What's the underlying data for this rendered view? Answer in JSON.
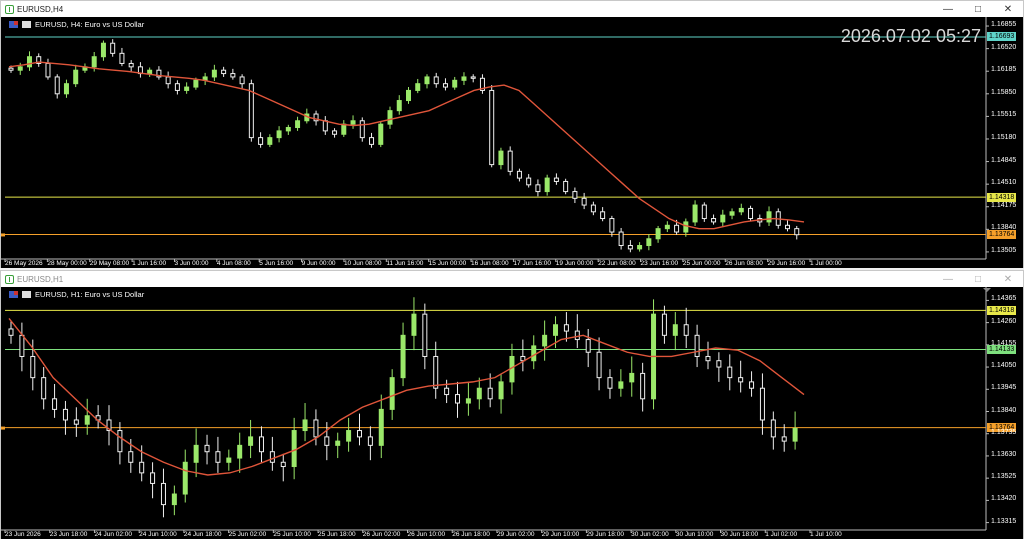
{
  "window1": {
    "title": "EURUSD,H4",
    "header": "EURUSD, H4:  Euro vs US Dollar",
    "clock": "2026.07.02 05:27",
    "price_scale": [
      "1.16855",
      "1.16520",
      "1.16185",
      "1.15850",
      "1.15515",
      "1.15180",
      "1.14845",
      "1.14510",
      "1.14175",
      "1.13840",
      "1.13505"
    ],
    "levels": [
      {
        "value": "1.16693",
        "color": "#5fd3c8"
      },
      {
        "value": "1.14318",
        "color": "#e8e84a"
      },
      {
        "value": "1.13764",
        "color": "#f5a02a"
      }
    ],
    "time_labels": [
      "26 May 2026",
      "28 May 00:00",
      "29 May 08:00",
      "1 Jun 16:00",
      "3 Jun 00:00",
      "4 Jun 08:00",
      "5 Jun 16:00",
      "9 Jun 00:00",
      "10 Jun 08:00",
      "11 Jun 16:00",
      "15 Jun 00:00",
      "16 Jun 08:00",
      "17 Jun 16:00",
      "19 Jun 00:00",
      "22 Jun 08:00",
      "23 Jun 16:00",
      "25 Jun 00:00",
      "26 Jun 08:00",
      "29 Jun 16:00",
      "1 Jul 00:00"
    ]
  },
  "window2": {
    "title": "EURUSD,H1",
    "header": "EURUSD, H1:  Euro vs US Dollar",
    "price_scale": [
      "1.14365",
      "1.14260",
      "1.14155",
      "1.14050",
      "1.13945",
      "1.13840",
      "1.13735",
      "1.13630",
      "1.13525",
      "1.13420",
      "1.13315"
    ],
    "levels": [
      {
        "value": "1.14318",
        "color": "#e8e84a"
      },
      {
        "value": "1.14133",
        "color": "#7ee07e"
      },
      {
        "value": "1.13764",
        "color": "#f5a02a"
      }
    ],
    "time_labels": [
      "23 Jun 2026",
      "23 Jun 18:00",
      "24 Jun 02:00",
      "24 Jun 10:00",
      "24 Jun 18:00",
      "25 Jun 02:00",
      "25 Jun 10:00",
      "25 Jun 18:00",
      "26 Jun 02:00",
      "26 Jun 10:00",
      "26 Jun 18:00",
      "29 Jun 02:00",
      "29 Jun 10:00",
      "29 Jun 18:00",
      "30 Jun 02:00",
      "30 Jun 10:00",
      "30 Jun 18:00",
      "1 Jul 02:00",
      "1 Jul 10:00"
    ]
  },
  "colors": {
    "bull": "#9be86a",
    "bear": "#f0f0f0",
    "ma": "#e0553a",
    "chart_bg": "#000000"
  },
  "chart_data": [
    {
      "type": "candlestick",
      "title": "EURUSD, H4:  Euro vs US Dollar",
      "ylim": [
        1.134,
        1.169
      ],
      "close_series_approx": [
        1.162,
        1.1625,
        1.164,
        1.163,
        1.161,
        1.1585,
        1.16,
        1.162,
        1.1625,
        1.164,
        1.166,
        1.1645,
        1.163,
        1.1625,
        1.1615,
        1.162,
        1.161,
        1.16,
        1.159,
        1.1595,
        1.1605,
        1.161,
        1.162,
        1.1615,
        1.161,
        1.16,
        1.152,
        1.151,
        1.152,
        1.153,
        1.1535,
        1.1545,
        1.1555,
        1.1545,
        1.153,
        1.1525,
        1.154,
        1.1545,
        1.152,
        1.151,
        1.154,
        1.156,
        1.1575,
        1.159,
        1.16,
        1.161,
        1.16,
        1.1595,
        1.1605,
        1.161,
        1.1608,
        1.159,
        1.148,
        1.15,
        1.147,
        1.146,
        1.145,
        1.144,
        1.146,
        1.1455,
        1.144,
        1.143,
        1.142,
        1.141,
        1.14,
        1.138,
        1.136,
        1.1355,
        1.136,
        1.137,
        1.1385,
        1.139,
        1.138,
        1.1395,
        1.142,
        1.14,
        1.1395,
        1.1405,
        1.141,
        1.1415,
        1.14,
        1.1395,
        1.141,
        1.139,
        1.1385,
        1.1376
      ],
      "ma_series_approx": [
        1.1625,
        1.1628,
        1.1632,
        1.163,
        1.1628,
        1.1625,
        1.1622,
        1.162,
        1.1618,
        1.1615,
        1.1612,
        1.161,
        1.1608,
        1.1605,
        1.16,
        1.1595,
        1.159,
        1.158,
        1.157,
        1.156,
        1.155,
        1.1545,
        1.154,
        1.1538,
        1.154,
        1.1545,
        1.155,
        1.1555,
        1.156,
        1.157,
        1.158,
        1.159,
        1.1595,
        1.1598,
        1.159,
        1.157,
        1.155,
        1.153,
        1.151,
        1.149,
        1.147,
        1.145,
        1.143,
        1.1415,
        1.14,
        1.139,
        1.1385,
        1.1385,
        1.139,
        1.1395,
        1.1398,
        1.14,
        1.1398,
        1.1395
      ]
    },
    {
      "type": "candlestick",
      "title": "EURUSD, H1:  Euro vs US Dollar",
      "ylim": [
        1.1328,
        1.144
      ],
      "close_series_approx": [
        1.142,
        1.141,
        1.14,
        1.139,
        1.1385,
        1.138,
        1.1378,
        1.1382,
        1.138,
        1.1375,
        1.1365,
        1.136,
        1.1355,
        1.135,
        1.134,
        1.1345,
        1.136,
        1.1368,
        1.1365,
        1.136,
        1.1362,
        1.1368,
        1.1372,
        1.1365,
        1.136,
        1.1358,
        1.1375,
        1.138,
        1.1372,
        1.1368,
        1.137,
        1.1375,
        1.1372,
        1.1368,
        1.1385,
        1.14,
        1.142,
        1.143,
        1.141,
        1.1395,
        1.1392,
        1.1388,
        1.139,
        1.1395,
        1.139,
        1.1398,
        1.141,
        1.1408,
        1.1415,
        1.142,
        1.1425,
        1.1422,
        1.1418,
        1.1412,
        1.14,
        1.1395,
        1.1398,
        1.1402,
        1.139,
        1.143,
        1.142,
        1.1425,
        1.142,
        1.141,
        1.1408,
        1.1405,
        1.14,
        1.1398,
        1.1395,
        1.138,
        1.1372,
        1.137,
        1.1376
      ],
      "ma_series_approx": [
        1.1428,
        1.1415,
        1.14,
        1.139,
        1.138,
        1.1372,
        1.1365,
        1.136,
        1.1356,
        1.1354,
        1.1355,
        1.1358,
        1.1362,
        1.1366,
        1.1372,
        1.138,
        1.1386,
        1.139,
        1.1394,
        1.1396,
        1.1397,
        1.1398,
        1.14,
        1.1406,
        1.1412,
        1.1418,
        1.142,
        1.1416,
        1.1412,
        1.141,
        1.141,
        1.1412,
        1.1414,
        1.1413,
        1.1408,
        1.14,
        1.1392
      ]
    }
  ]
}
